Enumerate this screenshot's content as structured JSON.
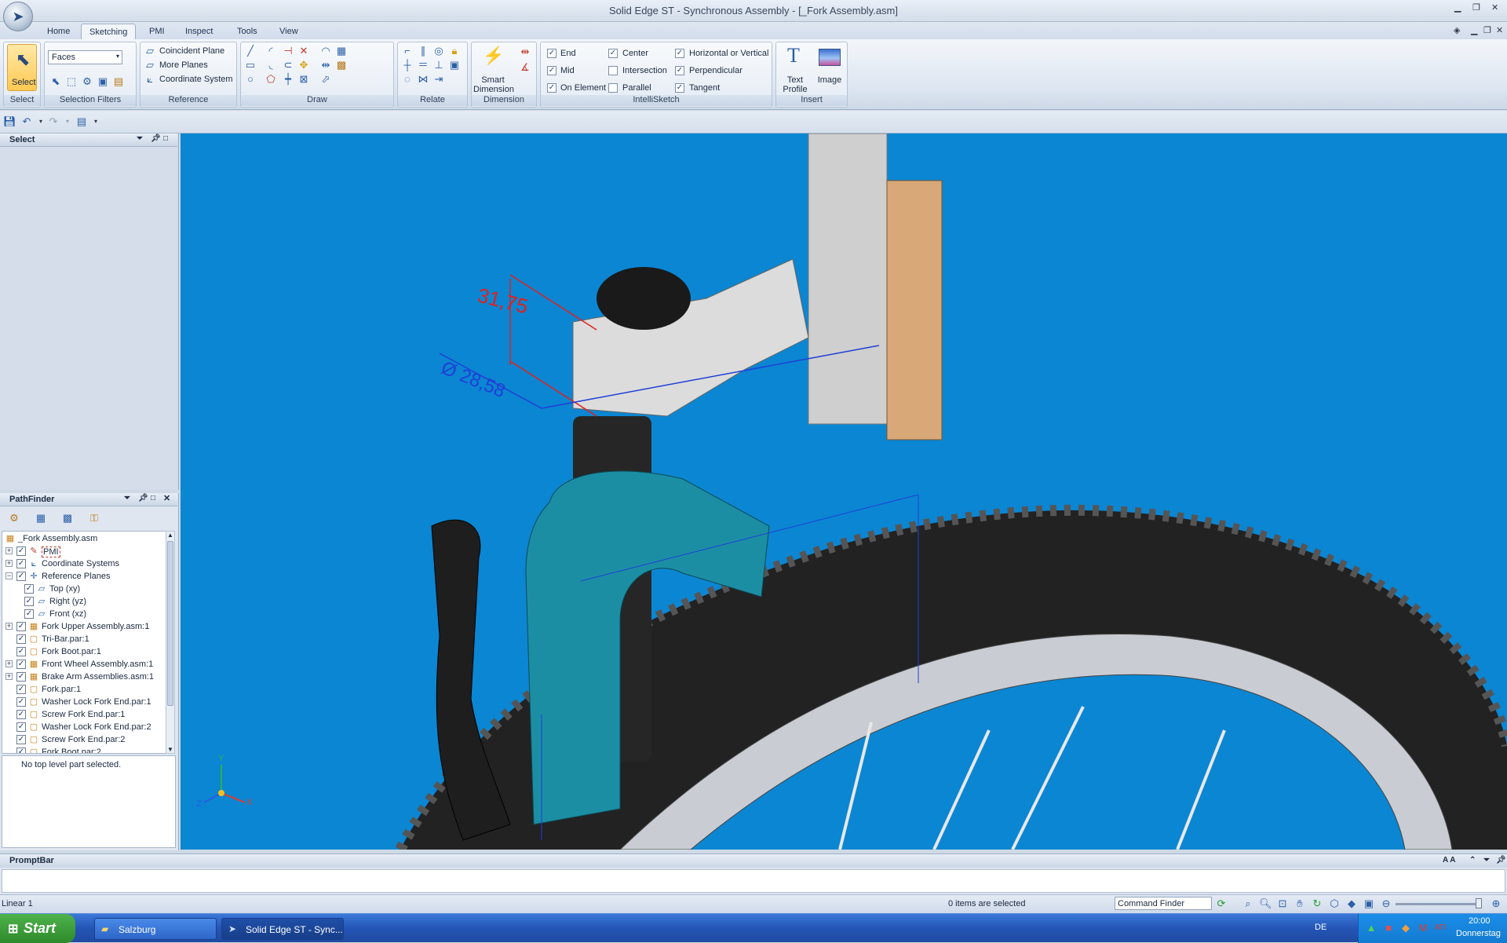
{
  "window": {
    "title": "Solid Edge ST - Synchronous Assembly - [_Fork Assembly.asm]"
  },
  "ribbon_tabs": [
    "Home",
    "Sketching",
    "PMI",
    "Inspect",
    "Tools",
    "View"
  ],
  "ribbon": {
    "select": {
      "button": "Select",
      "group": "Select"
    },
    "selection_filters": {
      "dropdown_value": "Faces",
      "group": "Selection Filters"
    },
    "reference": {
      "coincident_plane": "Coincident Plane",
      "more_planes": "More Planes",
      "coordinate_system": "Coordinate System",
      "group": "Reference"
    },
    "draw": {
      "group": "Draw"
    },
    "relate": {
      "group": "Relate"
    },
    "dimension": {
      "smart_dimension": "Smart Dimension",
      "group": "Dimension"
    },
    "intellisketch": {
      "group": "IntelliSketch",
      "options": [
        {
          "label": "End",
          "checked": true
        },
        {
          "label": "Center",
          "checked": true
        },
        {
          "label": "Horizontal or Vertical",
          "checked": true
        },
        {
          "label": "Mid",
          "checked": true
        },
        {
          "label": "Intersection",
          "checked": false
        },
        {
          "label": "Perpendicular",
          "checked": true
        },
        {
          "label": "On Element",
          "checked": true
        },
        {
          "label": "Parallel",
          "checked": false
        },
        {
          "label": "Tangent",
          "checked": true
        }
      ]
    },
    "insert": {
      "text_profile": "Text Profile",
      "image": "Image",
      "group": "Insert"
    }
  },
  "select_panel": {
    "title": "Select"
  },
  "pathfinder": {
    "title": "PathFinder",
    "items": [
      {
        "label": "_Fork Assembly.asm",
        "icon": "assembly-icon"
      },
      {
        "label": "PMI",
        "icon": "pmi-icon"
      },
      {
        "label": "Coordinate Systems",
        "icon": "coordinate-system-icon"
      },
      {
        "label": "Reference Planes",
        "icon": "reference-planes-icon"
      },
      {
        "label": "Top (xy)",
        "icon": "plane-icon"
      },
      {
        "label": "Right (yz)",
        "icon": "plane-icon"
      },
      {
        "label": "Front (xz)",
        "icon": "plane-icon"
      },
      {
        "label": "Fork Upper Assembly.asm:1",
        "icon": "assembly-icon"
      },
      {
        "label": "Tri-Bar.par:1",
        "icon": "part-icon"
      },
      {
        "label": "Fork Boot.par:1",
        "icon": "part-icon"
      },
      {
        "label": "Front Wheel Assembly.asm:1",
        "icon": "assembly-icon"
      },
      {
        "label": "Brake Arm Assemblies.asm:1",
        "icon": "assembly-icon"
      },
      {
        "label": "Fork.par:1",
        "icon": "part-icon"
      },
      {
        "label": "Washer Lock Fork End.par:1",
        "icon": "part-icon"
      },
      {
        "label": "Screw Fork End.par:1",
        "icon": "part-icon"
      },
      {
        "label": "Washer Lock Fork End.par:2",
        "icon": "part-icon"
      },
      {
        "label": "Screw Fork End.par:2",
        "icon": "part-icon"
      },
      {
        "label": "Fork Boot.par:2",
        "icon": "part-icon"
      }
    ],
    "status": "No top level part selected."
  },
  "viewport": {
    "dimension_height": "31,75",
    "dimension_diameter": "Ø 28,58",
    "triad_labels": {
      "x": "X",
      "y": "Y",
      "z": "Z"
    }
  },
  "promptbar": {
    "title": "PromptBar"
  },
  "statusbar": {
    "left": "Linear 1",
    "selection": "0 items are selected",
    "command_finder": "Command Finder"
  },
  "taskbar": {
    "start": "Start",
    "tasks": [
      "Salzburg",
      "Solid Edge ST - Sync..."
    ],
    "lang": "DE",
    "time": "20:00",
    "day": "Donnerstag"
  },
  "colors": {
    "viewport_bg": "#0b86d2",
    "dim_red": "#e3201b",
    "dim_blue": "#1f3fd8",
    "fork_boot_teal": "#1b8ea4"
  }
}
